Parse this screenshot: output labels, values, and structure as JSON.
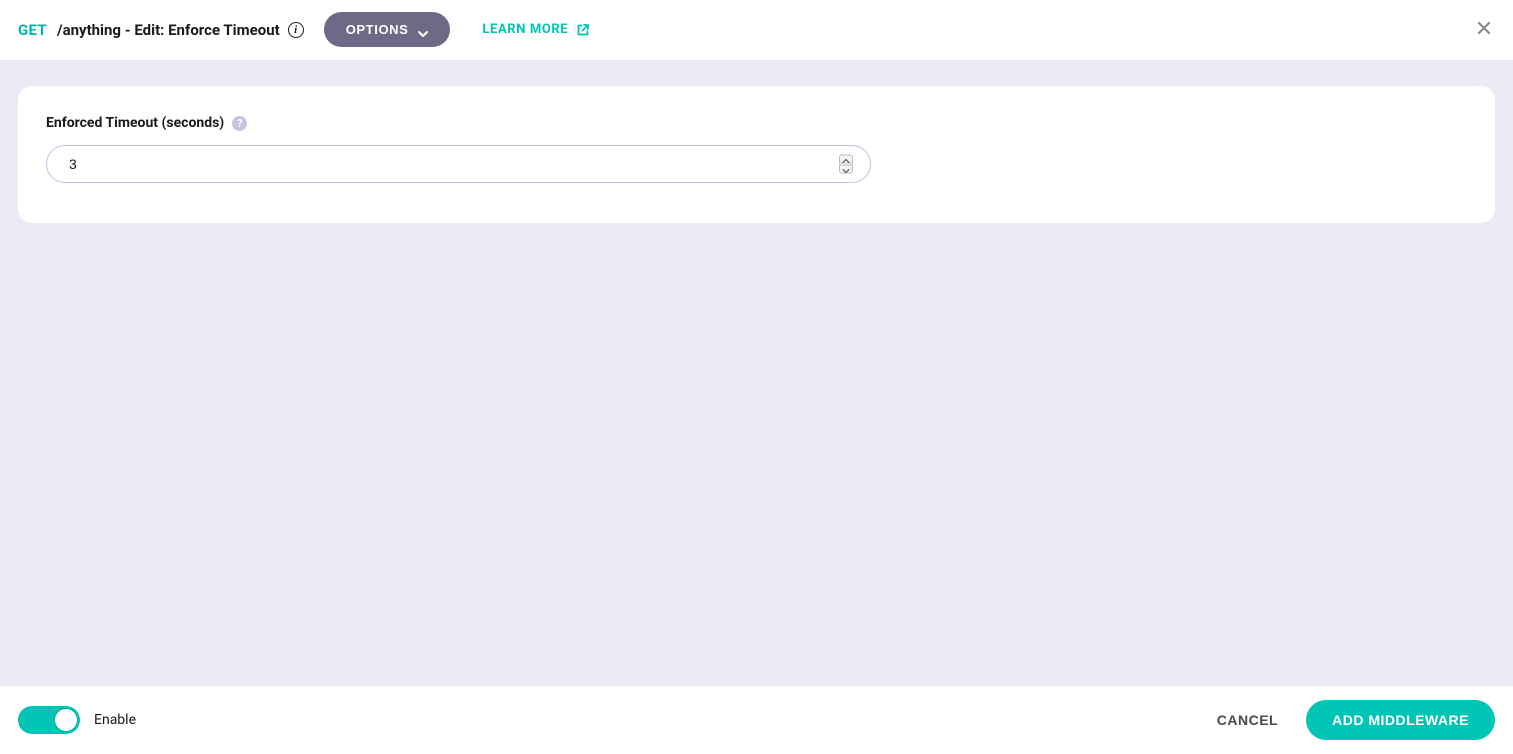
{
  "header": {
    "method": "GET",
    "title": "/anything - Edit: Enforce Timeout",
    "options_label": "OPTIONS",
    "learn_more_label": "LEARN MORE"
  },
  "form": {
    "timeout_label": "Enforced Timeout (seconds)",
    "timeout_value": "3"
  },
  "footer": {
    "toggle_on": true,
    "toggle_label": "Enable",
    "cancel_label": "CANCEL",
    "primary_label": "ADD MIDDLEWARE"
  },
  "colors": {
    "accent": "#00c4b4",
    "options_bg": "#6d6986",
    "page_bg": "#eceaf5",
    "input_border": "#c4bee2"
  }
}
